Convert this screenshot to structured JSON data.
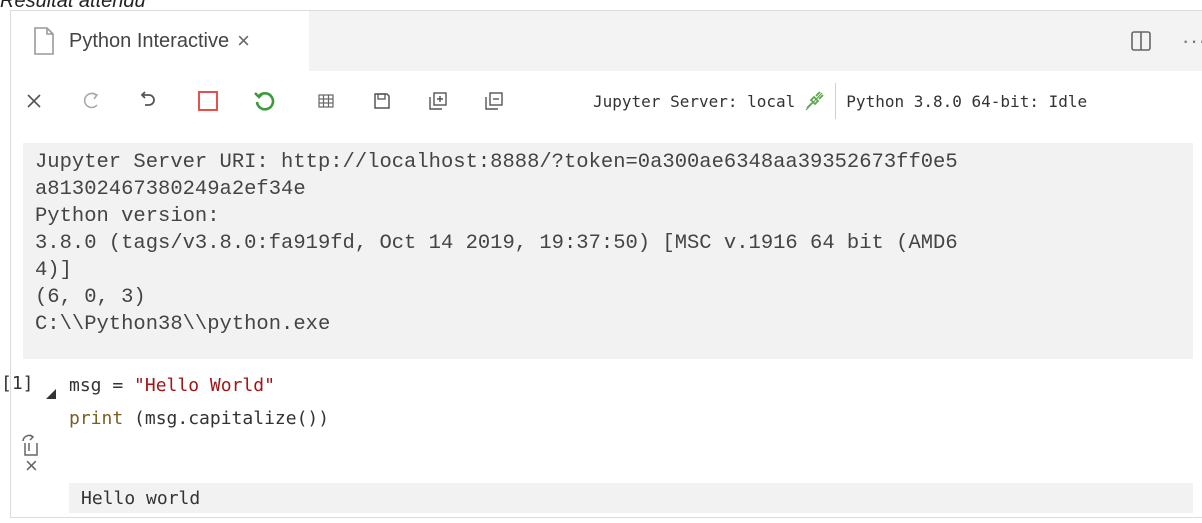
{
  "page": {
    "heading": "Résultat attendu"
  },
  "tab": {
    "title": "Python Interactive",
    "close": "×"
  },
  "editor_actions": {
    "more": "···"
  },
  "toolbar": {
    "server_label": "Jupyter Server: local",
    "kernel_label": "Python 3.8.0 64-bit: Idle",
    "icons": [
      "close-icon",
      "redo-icon",
      "undo-icon",
      "interrupt-kernel-icon",
      "restart-kernel-icon",
      "variables-icon",
      "save-icon",
      "expand-all-icon",
      "collapse-all-icon"
    ]
  },
  "info": {
    "text": "Jupyter Server URI: http://localhost:8888/?token=0a300ae6348aa39352673ff0e5\na81302467380249a2ef34e\nPython version:\n3.8.0 (tags/v3.8.0:fa919fd, Oct 14 2019, 19:37:50) [MSC v.1916 64 bit (AMD6\n4)]\n(6, 0, 3)\nC:\\\\Python38\\\\python.exe"
  },
  "cell": {
    "execution_count": "[1]",
    "code": {
      "line1_var": "msg = ",
      "line1_str": "\"Hello World\"",
      "line2_kw": "print",
      "line2_rest": " (msg.capitalize())"
    },
    "output": "Hello world"
  },
  "colors": {
    "interrupt": "#e8514a",
    "restart": "#3c9a3c",
    "plug": "#5fa84f",
    "string": "#a31515",
    "keyword": "#795e26"
  }
}
